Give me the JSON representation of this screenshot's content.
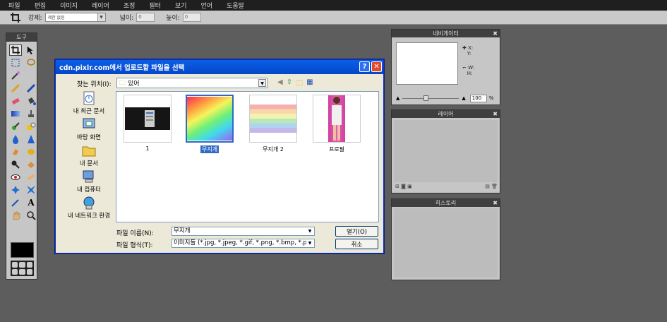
{
  "menu": [
    "파일",
    "편집",
    "이미지",
    "레이어",
    "조정",
    "필터",
    "보기",
    "언어",
    "도움말"
  ],
  "options": {
    "constrain_label": "강제:",
    "constrain_value": "제한 없음",
    "width_label": "넓이:",
    "width_value": "0",
    "height_label": "높이:",
    "height_value": "0"
  },
  "tools_panel": {
    "title": "도구"
  },
  "navigator": {
    "title": "네비게이터",
    "x_label": "X:",
    "y_label": "Y:",
    "w_label": "W:",
    "h_label": "H:",
    "zoom_value": "100",
    "zoom_unit": "%",
    "zoom_level": 0.4
  },
  "layers_panel": {
    "title": "레이어"
  },
  "history_panel": {
    "title": "히스토리"
  },
  "dialog": {
    "title": "cdn.pixlr.com에서 업로드할 파일을 선택",
    "help": "?",
    "close": "✕",
    "lookin_label": "찾는 위치(I):",
    "lookin_value": "있어",
    "places": [
      {
        "label": "내 최근 문서"
      },
      {
        "label": "바탕 화면"
      },
      {
        "label": "내 문서"
      },
      {
        "label": "내 컴퓨터"
      },
      {
        "label": "내 네트워크 환경"
      }
    ],
    "files": [
      {
        "name": "1"
      },
      {
        "name": "무지개"
      },
      {
        "name": "무지개 2"
      },
      {
        "name": "프로필"
      }
    ],
    "filename_label": "파일 이름(N):",
    "filename_value": "무지개",
    "filetype_label": "파일 형식(T):",
    "filetype_value": "이미지들 (*.jpg, *.jpeg, *.gif, *.png, *.bmp, *.p",
    "open_button": "열기(O)",
    "cancel_button": "취소"
  },
  "colors": {
    "accent": "#0a5fe6",
    "selection": "#316ac5"
  }
}
